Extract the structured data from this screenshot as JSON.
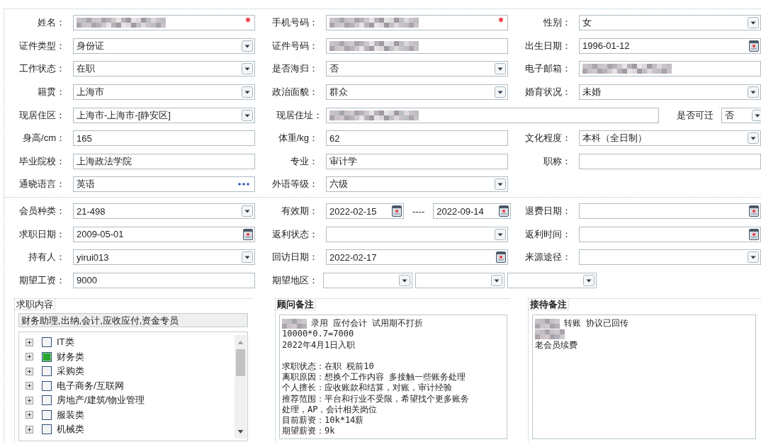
{
  "sections": [
    {
      "rows": [
        {
          "kind": "standard",
          "cells": [
            {
              "label": "姓名：",
              "fields": [
                {
                  "kind": "text",
                  "redacted": true,
                  "required": true
                }
              ]
            },
            {
              "label": "手机号码：",
              "fields": [
                {
                  "kind": "text",
                  "redacted": true,
                  "required": true
                }
              ]
            },
            {
              "label": "性别：",
              "fields": [
                {
                  "kind": "select",
                  "value": "女"
                }
              ]
            }
          ]
        },
        {
          "kind": "standard",
          "cells": [
            {
              "label": "证件类型：",
              "fields": [
                {
                  "kind": "select",
                  "value": "身份证"
                }
              ]
            },
            {
              "label": "证件号码：",
              "fields": [
                {
                  "kind": "text",
                  "redacted": true
                }
              ]
            },
            {
              "label": "出生日期：",
              "fields": [
                {
                  "kind": "date",
                  "value": "1996-01-12"
                }
              ]
            }
          ]
        },
        {
          "kind": "standard",
          "cells": [
            {
              "label": "工作状态：",
              "fields": [
                {
                  "kind": "select",
                  "value": "在职"
                }
              ]
            },
            {
              "label": "是否海归：",
              "fields": [
                {
                  "kind": "select",
                  "value": "否"
                }
              ]
            },
            {
              "label": "电子邮箱：",
              "fields": [
                {
                  "kind": "text",
                  "redacted": true
                }
              ]
            }
          ]
        },
        {
          "kind": "standard",
          "cells": [
            {
              "label": "籍贯：",
              "fields": [
                {
                  "kind": "select",
                  "value": "上海市"
                }
              ]
            },
            {
              "label": "政治面貌：",
              "fields": [
                {
                  "kind": "select",
                  "value": "群众"
                }
              ]
            },
            {
              "label": "婚育状况：",
              "fields": [
                {
                  "kind": "select",
                  "value": "未婚"
                }
              ]
            }
          ]
        },
        {
          "kind": "wide",
          "cells": [
            {
              "label": "现居住区：",
              "fields": [
                {
                  "kind": "select",
                  "value": "上海市-上海市-[静安区]"
                }
              ]
            },
            {
              "label": "现居住址：",
              "fields": [
                {
                  "kind": "text",
                  "redacted": true
                }
              ]
            },
            {
              "label": "是否可迁",
              "fields": [
                {
                  "kind": "select",
                  "value": "否"
                }
              ]
            }
          ]
        },
        {
          "kind": "standard",
          "cells": [
            {
              "label": "身高/cm：",
              "fields": [
                {
                  "kind": "text",
                  "value": "165"
                }
              ]
            },
            {
              "label": "体重/kg：",
              "fields": [
                {
                  "kind": "text",
                  "value": "62"
                }
              ]
            },
            {
              "label": "文化程度：",
              "fields": [
                {
                  "kind": "select",
                  "value": "本科（全日制）"
                }
              ]
            }
          ]
        },
        {
          "kind": "standard",
          "cells": [
            {
              "label": "毕业院校：",
              "fields": [
                {
                  "kind": "text",
                  "value": "上海政法学院"
                }
              ]
            },
            {
              "label": "专业：",
              "fields": [
                {
                  "kind": "text",
                  "value": "审计学"
                }
              ]
            },
            {
              "label": "职称：",
              "fields": [
                {
                  "kind": "text"
                }
              ]
            }
          ]
        },
        {
          "kind": "standard",
          "cells": [
            {
              "label": "通晓语言：",
              "fields": [
                {
                  "kind": "lookup",
                  "value": "英语"
                }
              ]
            },
            {
              "label": "外语等级：",
              "fields": [
                {
                  "kind": "select",
                  "value": "六级"
                }
              ]
            }
          ]
        }
      ]
    },
    {
      "rows": [
        {
          "kind": "standard",
          "cells": [
            {
              "label": "会员种类：",
              "fields": [
                {
                  "kind": "select",
                  "value": "21-498"
                }
              ]
            },
            {
              "label": "有效期：",
              "fields": [
                {
                  "kind": "date",
                  "value": "2022-02-15"
                },
                {
                  "kind": "date",
                  "value": "2022-09-14"
                }
              ],
              "separator": "----"
            },
            {
              "label": "退费日期：",
              "fields": [
                {
                  "kind": "date"
                }
              ]
            }
          ]
        },
        {
          "kind": "standard",
          "cells": [
            {
              "label": "求职日期：",
              "fields": [
                {
                  "kind": "date",
                  "value": "2009-05-01"
                }
              ]
            },
            {
              "label": "返利状态：",
              "fields": [
                {
                  "kind": "select"
                }
              ]
            },
            {
              "label": "返利时间：",
              "fields": [
                {
                  "kind": "date"
                }
              ]
            }
          ]
        },
        {
          "kind": "standard",
          "cells": [
            {
              "label": "持有人：",
              "fields": [
                {
                  "kind": "select",
                  "value": "yirui013"
                }
              ]
            },
            {
              "label": "回访日期：",
              "fields": [
                {
                  "kind": "date",
                  "value": "2022-02-17"
                }
              ]
            },
            {
              "label": "来源途径：",
              "fields": [
                {
                  "kind": "select"
                }
              ]
            }
          ]
        },
        {
          "kind": "standard",
          "cells": [
            {
              "label": "期望工资：",
              "fields": [
                {
                  "kind": "text",
                  "value": "9000"
                }
              ]
            },
            {
              "label": "期望地区：",
              "fields": [
                {
                  "kind": "select"
                },
                {
                  "kind": "select"
                },
                {
                  "kind": "select"
                }
              ]
            }
          ]
        }
      ]
    }
  ],
  "panels": [
    {
      "kind": "categories",
      "title": "求职内容",
      "summary": "财务助理,出纳,会计,应收应付,资金专员",
      "items": [
        {
          "label": "IT类",
          "checked": false
        },
        {
          "label": "财务类",
          "checked": true
        },
        {
          "label": "采购类",
          "checked": false
        },
        {
          "label": "电子商务/互联网",
          "checked": false
        },
        {
          "label": "房地产/建筑/物业管理",
          "checked": false
        },
        {
          "label": "服装类",
          "checked": false
        },
        {
          "label": "机械类",
          "checked": false
        }
      ]
    },
    {
      "kind": "notes",
      "title": "顾问备注",
      "lines": [
        {
          "kind": "text",
          "redacted": true,
          "text": "录用 应付会计 试用期不打折"
        },
        {
          "kind": "text",
          "text": "10000*0.7=7000"
        },
        {
          "kind": "text",
          "text": "2022年4月1日入职"
        },
        {
          "kind": "blank"
        },
        {
          "kind": "text",
          "text": "求职状态：在职 税前10"
        },
        {
          "kind": "text",
          "text": "离职原因：想换个工作内容 多接触一些账务处理"
        },
        {
          "kind": "text",
          "text": "个人擅长：应收账款和结算，对账，审计经验"
        },
        {
          "kind": "text",
          "text": "推荐范围：平台和行业不受限，希望找个更多账务"
        },
        {
          "kind": "text",
          "text": "处理，AP，会计相关岗位"
        },
        {
          "kind": "text",
          "text": "目前薪资：10k*14薪"
        },
        {
          "kind": "text",
          "text": "期望薪资：9k"
        }
      ]
    },
    {
      "kind": "notes",
      "title": "接待备注",
      "lines": [
        {
          "kind": "text",
          "redacted": true,
          "text": "转账 协议已回传"
        },
        {
          "kind": "text",
          "redacted": true
        },
        {
          "kind": "text",
          "text": "老会员续费"
        }
      ]
    }
  ]
}
